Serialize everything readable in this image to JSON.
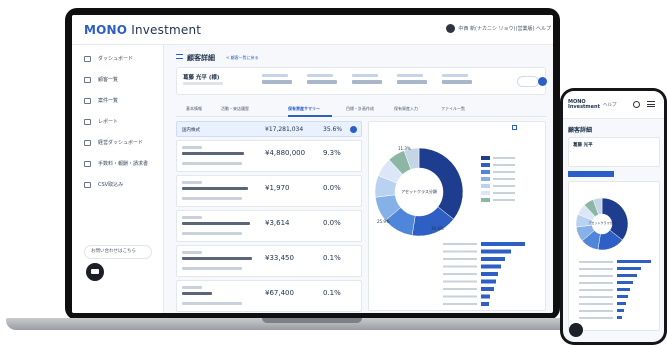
{
  "app": {
    "logo_brand": "MONO",
    "logo_rest": " Investment",
    "user_label": "中西 新(ナカニシ リョウ)(営業版)  ヘルプ"
  },
  "sidebar": {
    "items": [
      {
        "label": "ダッシュボード",
        "icon": "grid-icon"
      },
      {
        "label": "顧客一覧",
        "icon": "list-icon"
      },
      {
        "label": "案件一覧",
        "icon": "folder-icon"
      },
      {
        "label": "レポート",
        "icon": "report-icon"
      },
      {
        "label": "経営ダッシュボード",
        "icon": "org-icon"
      },
      {
        "label": "手数料・報酬・請求書",
        "icon": "money-icon"
      },
      {
        "label": "CSV取込み",
        "icon": "csv-icon"
      }
    ],
    "chat_label": "お問い合わせはこちら"
  },
  "main": {
    "page_title": "顧客詳細",
    "back_link": "< 顧客一覧に戻る",
    "customer_name": "葛藤 光平 (様)",
    "tabs": [
      {
        "label": "基本情報"
      },
      {
        "label": "活動・来店履歴"
      },
      {
        "label": "保有資産サマリー",
        "active": true
      },
      {
        "label": "目標・計画作成"
      },
      {
        "label": "保有資産入力"
      },
      {
        "label": "ファイル一覧"
      }
    ],
    "summary_row": {
      "label": "国内株式",
      "value": "¥17,281,034",
      "percent": "35.6%"
    },
    "holdings": [
      {
        "value": "¥4,880,000",
        "percent": "9.3%"
      },
      {
        "value": "¥1,970",
        "percent": "0.0%"
      },
      {
        "value": "¥3,614",
        "percent": "0.0%"
      },
      {
        "value": "¥33,450",
        "percent": "0.1%"
      },
      {
        "value": "¥67,400",
        "percent": "0.1%"
      }
    ],
    "chart_panel": {
      "checkbox_label": "",
      "donut_center_label": "アセットクラス分類",
      "slice_labels": [
        "11.3%",
        "16.9%",
        "25.9%"
      ]
    }
  },
  "phone": {
    "logo_line1": "MONO",
    "logo_line2": "Investment",
    "help": "ヘルプ",
    "title": "顧客詳細",
    "customer_name": "葛藤 光平",
    "donut_center_label": "アセットクラス分類"
  },
  "colors": {
    "accent": "#2b5fc7",
    "donut": [
      "#1e3d8f",
      "#2e5fc4",
      "#4f86d9",
      "#86b0e8",
      "#b9d2f2",
      "#dbe7f8",
      "#8bb7a4",
      "#c5d5e8"
    ]
  }
}
